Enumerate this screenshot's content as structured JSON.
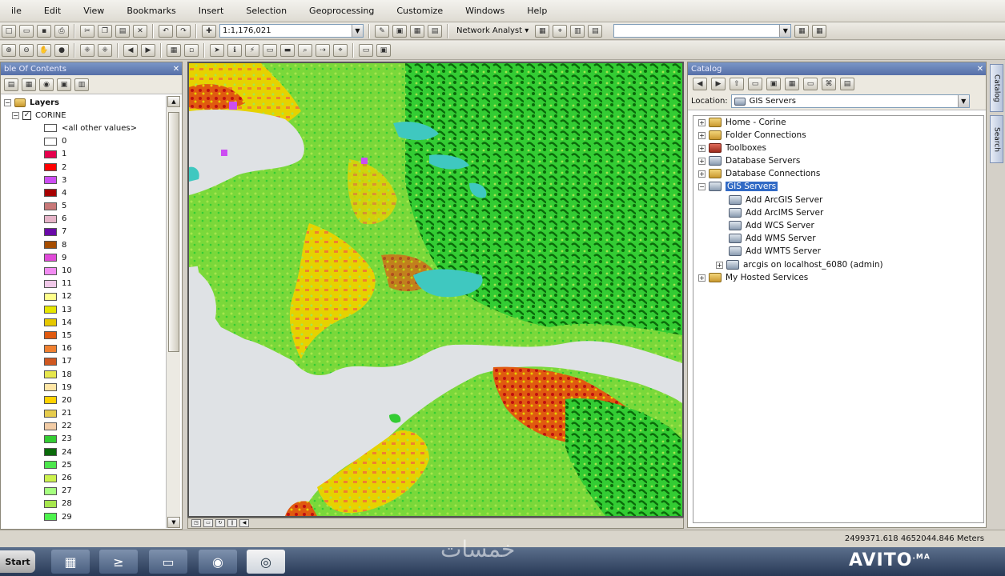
{
  "menu": [
    "ile",
    "Edit",
    "View",
    "Bookmarks",
    "Insert",
    "Selection",
    "Geoprocessing",
    "Customize",
    "Windows",
    "Help"
  ],
  "toolbar": {
    "scale": "1:1,176,021",
    "network_analyst": "Network Analyst ▾"
  },
  "toc": {
    "title": "ble Of Contents",
    "layers_label": "Layers",
    "layer_name": "CORINE",
    "all_other": "<all other values>",
    "classes": [
      {
        "label": "0",
        "color": "#ffffff"
      },
      {
        "label": "1",
        "color": "#e6004d"
      },
      {
        "label": "2",
        "color": "#ff0000"
      },
      {
        "label": "3",
        "color": "#cc4df2"
      },
      {
        "label": "4",
        "color": "#a60000"
      },
      {
        "label": "5",
        "color": "#c87878"
      },
      {
        "label": "6",
        "color": "#e6b4c8"
      },
      {
        "label": "7",
        "color": "#6a0aa8"
      },
      {
        "label": "8",
        "color": "#a64d00"
      },
      {
        "label": "9",
        "color": "#e04ad8"
      },
      {
        "label": "10",
        "color": "#f28cf2"
      },
      {
        "label": "11",
        "color": "#f0c8e8"
      },
      {
        "label": "12",
        "color": "#ffff8c"
      },
      {
        "label": "13",
        "color": "#e6e600"
      },
      {
        "label": "14",
        "color": "#e6c800"
      },
      {
        "label": "15",
        "color": "#e05a10"
      },
      {
        "label": "16",
        "color": "#f08030"
      },
      {
        "label": "17",
        "color": "#d05820"
      },
      {
        "label": "18",
        "color": "#e6e64d"
      },
      {
        "label": "19",
        "color": "#ffe6a6"
      },
      {
        "label": "20",
        "color": "#ffd200"
      },
      {
        "label": "21",
        "color": "#e6cc4d"
      },
      {
        "label": "22",
        "color": "#f2cca6"
      },
      {
        "label": "23",
        "color": "#33cc33"
      },
      {
        "label": "24",
        "color": "#0a6a0a"
      },
      {
        "label": "25",
        "color": "#4ce64c"
      },
      {
        "label": "26",
        "color": "#ccf24d"
      },
      {
        "label": "27",
        "color": "#a6ff80"
      },
      {
        "label": "28",
        "color": "#a6e64d"
      },
      {
        "label": "29",
        "color": "#4df24d"
      }
    ]
  },
  "catalog": {
    "title": "Catalog",
    "location_label": "Location:",
    "location_value": "GIS Servers",
    "tree": [
      {
        "label": "Home - Corine",
        "icon": "folder-icon"
      },
      {
        "label": "Folder Connections",
        "icon": "folder-icon"
      },
      {
        "label": "Toolboxes",
        "icon": "toolbox-icon"
      },
      {
        "label": "Database Servers",
        "icon": "server-icon"
      },
      {
        "label": "Database Connections",
        "icon": "folder-icon"
      },
      {
        "label": "GIS Servers",
        "icon": "server-icon"
      }
    ],
    "gis_children": [
      "Add ArcGIS Server",
      "Add ArcIMS Server",
      "Add WCS Server",
      "Add WMS Server",
      "Add WMTS Server",
      "arcgis on localhost_6080 (admin)"
    ],
    "hosted": "My Hosted Services"
  },
  "sidetabs": [
    "Catalog",
    "Search"
  ],
  "status": {
    "coordinates": "2499371.618  4652044.846 Meters"
  },
  "taskbar": {
    "start": "Start"
  },
  "watermarks": {
    "arabic": "خمسات",
    "avito": "AVITO",
    "avito_suffix": ".MA"
  },
  "colors": {
    "map_sea": "#dfe2e5",
    "map_water": "#3fc8c0",
    "forest_dark": "#0a6a0a",
    "forest": "#33cc33",
    "grass": "#a6e64d",
    "agri": "#e6d200",
    "urban": "#e05a10",
    "selection": "#316ac5"
  }
}
